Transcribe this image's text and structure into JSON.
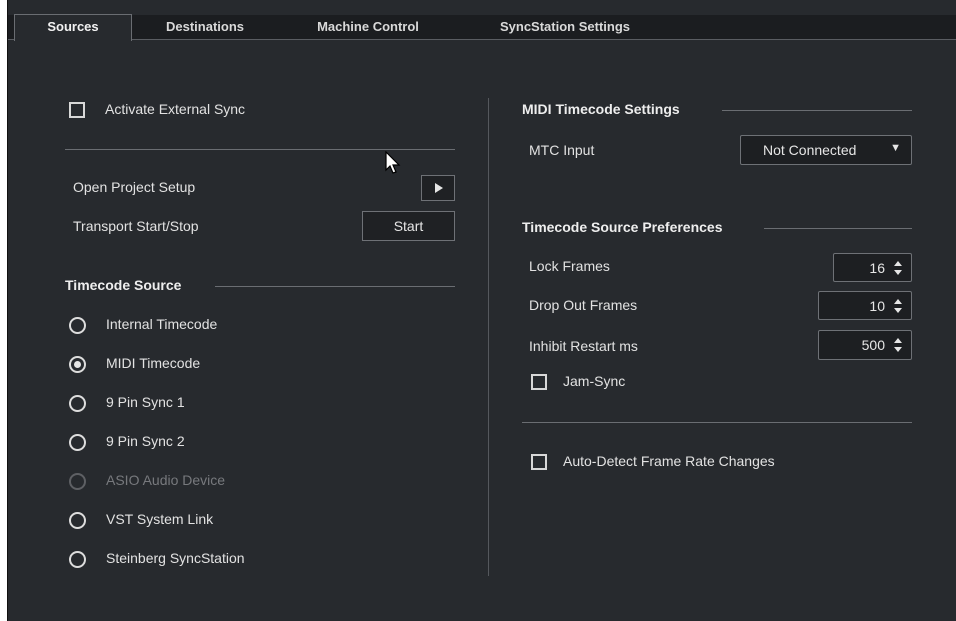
{
  "tabs": [
    {
      "label": "Sources",
      "active": true
    },
    {
      "label": "Destinations"
    },
    {
      "label": "Machine Control"
    },
    {
      "label": "SyncStation Settings"
    }
  ],
  "left": {
    "activate_external_sync": {
      "label": "Activate External Sync",
      "checked": false
    },
    "open_project_setup": {
      "label": "Open Project Setup"
    },
    "transport": {
      "label": "Transport Start/Stop",
      "button": "Start"
    },
    "timecode_source": {
      "title": "Timecode Source",
      "options": [
        {
          "label": "Internal Timecode",
          "selected": false,
          "enabled": true
        },
        {
          "label": "MIDI Timecode",
          "selected": true,
          "enabled": true
        },
        {
          "label": "9 Pin Sync 1",
          "selected": false,
          "enabled": true
        },
        {
          "label": "9 Pin Sync 2",
          "selected": false,
          "enabled": true
        },
        {
          "label": "ASIO Audio Device",
          "selected": false,
          "enabled": false
        },
        {
          "label": "VST System Link",
          "selected": false,
          "enabled": true
        },
        {
          "label": "Steinberg SyncStation",
          "selected": false,
          "enabled": true
        }
      ]
    }
  },
  "right": {
    "mtc": {
      "title": "MIDI Timecode Settings",
      "input_label": "MTC Input",
      "input_value": "Not Connected"
    },
    "prefs": {
      "title": "Timecode Source Preferences",
      "lock_frames": {
        "label": "Lock Frames",
        "value": "16"
      },
      "drop_out_frames": {
        "label": "Drop Out Frames",
        "value": "10"
      },
      "inhibit_restart": {
        "label": "Inhibit Restart ms",
        "value": "500"
      },
      "jam_sync": {
        "label": "Jam-Sync",
        "checked": false
      }
    },
    "auto_detect": {
      "label": "Auto-Detect Frame Rate Changes",
      "checked": false
    }
  },
  "icons": {
    "play": "play-icon",
    "spin": "spin-updown-icon",
    "dropdown": "triangle-down-icon"
  },
  "colors": {
    "panel_bg": "#272a2e",
    "tabbar_bg": "#1b1d20",
    "text": "#e6e6e6",
    "disabled": "#77797d"
  }
}
